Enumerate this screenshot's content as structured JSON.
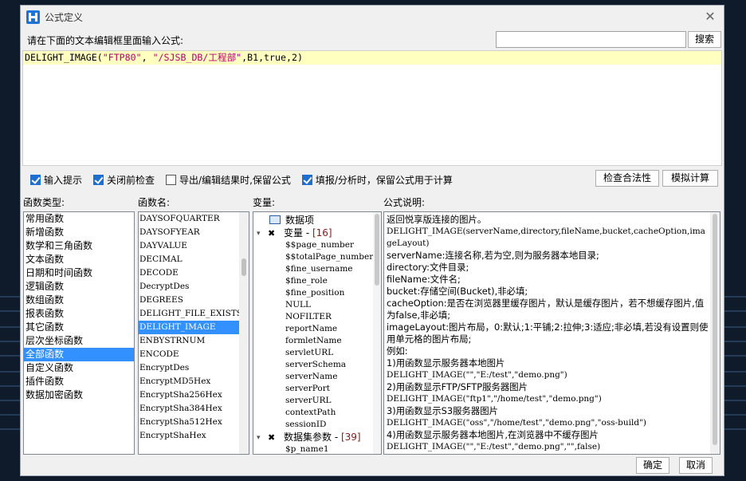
{
  "dialog": {
    "title": "公式定义",
    "prompt": "请在下面的文本编辑框里面输入公式:",
    "search_placeholder": "",
    "search_label": "搜索"
  },
  "editor": {
    "fn": "DELIGHT_IMAGE",
    "open": "(",
    "arg1": "\"FTP80\"",
    "sep1": ", ",
    "arg2": "\"/SJSB_DB/工程部\"",
    "rest": ",B1,true,2)"
  },
  "options": {
    "items": [
      {
        "label": "输入提示",
        "checked": true
      },
      {
        "label": "关闭前检查",
        "checked": true
      },
      {
        "label": "导出/编辑结果时,保留公式",
        "checked": false
      },
      {
        "label": "填报/分析时，保留公式用于计算",
        "checked": true
      }
    ],
    "validate_label": "检查合法性",
    "simulate_label": "模拟计算"
  },
  "columns": {
    "categories": "函数类型:",
    "functions": "函数名:",
    "variables": "变量:",
    "description": "公式说明:"
  },
  "categories": [
    {
      "label": "常用函数",
      "selected": false
    },
    {
      "label": "新增函数",
      "selected": false
    },
    {
      "label": "数学和三角函数",
      "selected": false
    },
    {
      "label": "文本函数",
      "selected": false
    },
    {
      "label": "日期和时间函数",
      "selected": false
    },
    {
      "label": "逻辑函数",
      "selected": false
    },
    {
      "label": "数组函数",
      "selected": false
    },
    {
      "label": "报表函数",
      "selected": false
    },
    {
      "label": "其它函数",
      "selected": false
    },
    {
      "label": "层次坐标函数",
      "selected": false
    },
    {
      "label": "全部函数",
      "selected": true
    },
    {
      "label": "自定义函数",
      "selected": false
    },
    {
      "label": "插件函数",
      "selected": false
    },
    {
      "label": "数据加密函数",
      "selected": false
    }
  ],
  "functions": [
    {
      "label": "DAYSOFQUARTER",
      "selected": false
    },
    {
      "label": "DAYSOFYEAR",
      "selected": false
    },
    {
      "label": "DAYVALUE",
      "selected": false
    },
    {
      "label": "DECIMAL",
      "selected": false
    },
    {
      "label": "DECODE",
      "selected": false
    },
    {
      "label": "DecryptDes",
      "selected": false
    },
    {
      "label": "DEGREES",
      "selected": false
    },
    {
      "label": "DELIGHT_FILE_EXISTS",
      "selected": false
    },
    {
      "label": "DELIGHT_IMAGE",
      "selected": true
    },
    {
      "label": "ENBYSTRNUM",
      "selected": false
    },
    {
      "label": "ENCODE",
      "selected": false
    },
    {
      "label": "EncryptDes",
      "selected": false
    },
    {
      "label": "EncryptMD5Hex",
      "selected": false
    },
    {
      "label": "EncryptSha256Hex",
      "selected": false
    },
    {
      "label": "EncryptSha384Hex",
      "selected": false
    },
    {
      "label": "EncryptSha512Hex",
      "selected": false
    },
    {
      "label": "EncryptShaHex",
      "selected": false
    }
  ],
  "variables": {
    "root_label": "数据项",
    "group1": {
      "label": "变量",
      "count": "[16]"
    },
    "group1_items": [
      "$$page_number",
      "$$totalPage_number",
      "$fine_username",
      "$fine_role",
      "$fine_position",
      "NULL",
      "NOFILTER",
      "reportName",
      "formletName",
      "servletURL",
      "serverSchema",
      "serverName",
      "serverPort",
      "serverURL",
      "contextPath",
      "sessionID"
    ],
    "group2": {
      "label": "数据集参数",
      "count": "[39]"
    },
    "group2_items": [
      "$p_name1"
    ]
  },
  "description": [
    {
      "text": "返回悦享版连接的图片。",
      "mono": false
    },
    {
      "text": "DELIGHT_IMAGE(serverName,directory,fileName,bucket,cacheOption,imageLayout)",
      "mono": true
    },
    {
      "text": "serverName:连接名称,若为空,则为服务器本地目录;",
      "mono": false
    },
    {
      "text": "directory:文件目录;",
      "mono": false
    },
    {
      "text": "fileName:文件名;",
      "mono": false
    },
    {
      "text": "bucket:存储空间(Bucket),非必填;",
      "mono": false
    },
    {
      "text": "cacheOption:是否在浏览器里缓存图片，默认是缓存图片，若不想缓存图片,值为false,非必填;",
      "mono": false
    },
    {
      "text": "imageLayout:图片布局，0:默认;1:平铺;2:拉伸;3:适应;非必填,若没有设置则使用单元格的图片布局;",
      "mono": false
    },
    {
      "text": "例如:",
      "mono": false
    },
    {
      "text": "1)用函数显示服务器本地图片",
      "mono": false
    },
    {
      "text": "DELIGHT_IMAGE(\"\",\"E:/test\",\"demo.png\")",
      "mono": true
    },
    {
      "text": "2)用函数显示FTP/SFTP服务器图片",
      "mono": false
    },
    {
      "text": "DELIGHT_IMAGE(\"ftp1\",\"/home/test\",\"demo.png\")",
      "mono": true
    },
    {
      "text": "3)用函数显示S3服务器图片",
      "mono": false
    },
    {
      "text": "DELIGHT_IMAGE(\"oss\",\"/home/test\",\"demo.png\",\"oss-build\")",
      "mono": true
    },
    {
      "text": "4)用函数显示服务器本地图片,在浏览器中不缓存图片",
      "mono": false
    },
    {
      "text": "DELIGHT_IMAGE(\"\",\"E:/test\",\"demo.png\",\"\",false)",
      "mono": true
    }
  ],
  "footer": {
    "ok_label": "确定",
    "cancel_label": "取消"
  },
  "colors": {
    "accent": "#3390ff",
    "check": "#1f6fd1",
    "string": "#b0006a",
    "editor_highlight": "#ffffc0"
  }
}
